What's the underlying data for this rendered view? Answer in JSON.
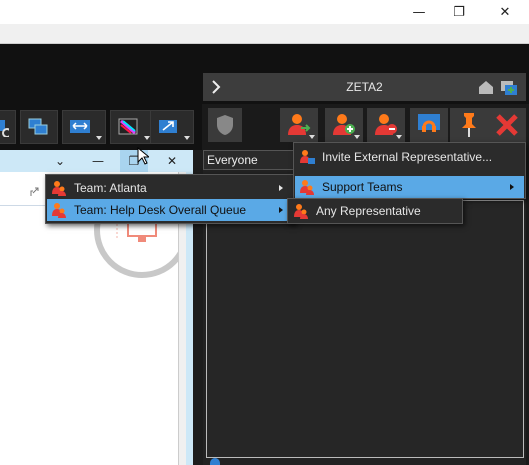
{
  "window": {
    "minimize": "—",
    "restore": "❐",
    "close": "✕"
  },
  "right_panel": {
    "title": "ZETA2",
    "dropdown_value": "Everyone"
  },
  "inner_window": {
    "collapse": "⌄",
    "minimize": "—",
    "restore": "❐",
    "close": "✕"
  },
  "menu_teams": {
    "items": [
      {
        "label": "Team: Atlanta"
      },
      {
        "label": "Team: Help Desk Overall Queue"
      }
    ]
  },
  "menu_invite": {
    "items": [
      {
        "label": "Invite External Representative..."
      },
      {
        "label": "Support Teams"
      }
    ]
  },
  "menu_support": {
    "items": [
      {
        "label": "Any Representative"
      }
    ]
  },
  "colors": {
    "highlight": "#5aa9e6",
    "accent_red": "#e53935",
    "accent_orange": "#ff7a1a"
  }
}
